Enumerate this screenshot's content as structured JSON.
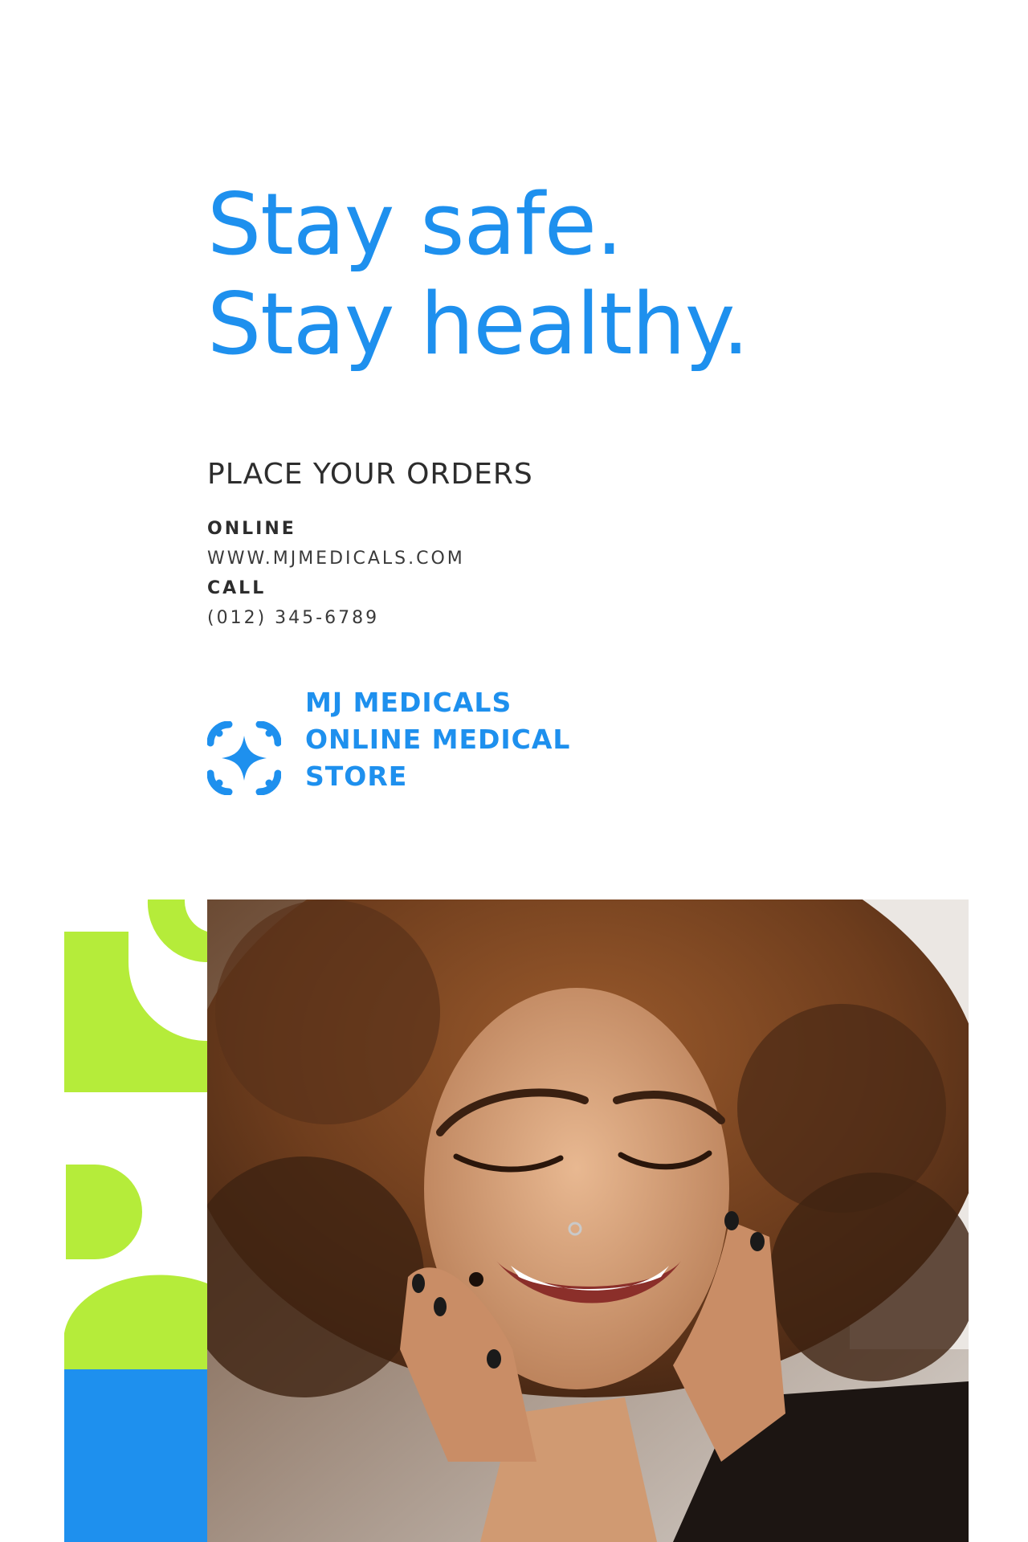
{
  "headline": {
    "line1": "Stay safe.",
    "line2": "Stay healthy."
  },
  "orders": {
    "title": "PLACE YOUR ORDERS",
    "online_label": "ONLINE",
    "online_value": "WWW.MJMEDICALS.COM",
    "call_label": "CALL",
    "call_value": "(012) 345-6789"
  },
  "brand": {
    "line1": "MJ MEDICALS",
    "line2": "ONLINE MEDICAL",
    "line3": "STORE"
  },
  "colors": {
    "primary_blue": "#1e90ee",
    "lime_green": "#b5ec3a",
    "dark_text": "#2d2d2d",
    "background": "#ffffff"
  },
  "icons": {
    "logo": "sparkle-logo-icon"
  },
  "image": {
    "subject": "smiling-woman-photo"
  }
}
